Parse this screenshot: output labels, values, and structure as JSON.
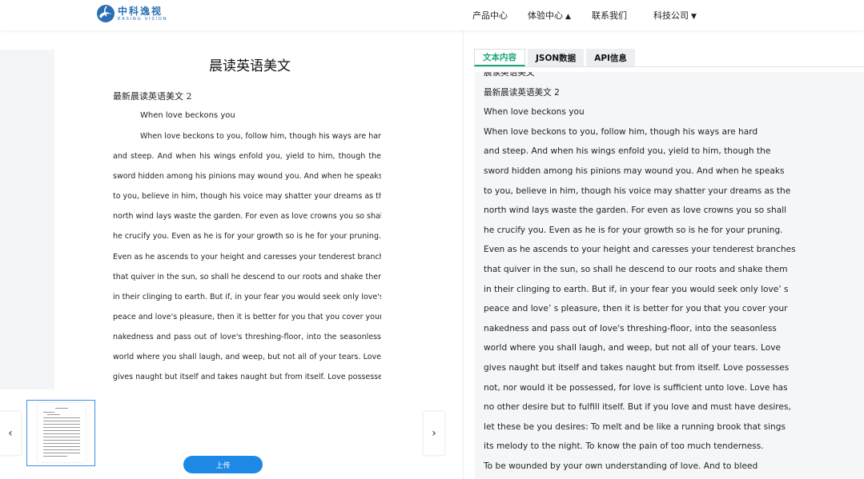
{
  "header": {
    "logo_cn": "中科逸视",
    "logo_en": "EASING VISION",
    "nav": [
      {
        "label": "产品中心",
        "caret": ""
      },
      {
        "label": "体验中心",
        "caret": "▲"
      },
      {
        "label": "联系我们",
        "caret": ""
      },
      {
        "label": "科技公司",
        "caret": "▼"
      }
    ]
  },
  "document": {
    "title": "晨读英语美文",
    "subtitle": "最新晨读英语美文 2",
    "heading": "When love beckons you",
    "lines": [
      "When love beckons to you, follow him, though his ways are hard",
      "and steep. And when his wings enfold you, yield to him, though the",
      "sword hidden among his pinions may wound you. And when he speaks",
      "to you, believe in him, though his voice may shatter your dreams as the",
      "north wind lays waste the garden. For even as love crowns you so shall",
      "he crucify you. Even as he is for your growth so is he for your pruning.",
      "Even as he ascends to your height and caresses your tenderest branches",
      "that quiver in the sun, so shall he descend to our roots and shake them",
      "in their clinging to earth. But if, in your fear you would seek only love's",
      "peace and love's pleasure, then it is better for you that you cover your",
      "nakedness and pass out of love's threshing-floor, into the seasonless",
      "world where you shall laugh, and weep, but not all of your tears. Love",
      "gives naught but itself and takes naught but from itself. Love possesses"
    ]
  },
  "controls": {
    "prev_arrow": "‹",
    "next_arrow": "›",
    "upload_label": "上传"
  },
  "tabs": [
    {
      "label": "文本内容",
      "active": true
    },
    {
      "label": "JSON数据",
      "active": false
    },
    {
      "label": "API信息",
      "active": false
    }
  ],
  "result": {
    "lines": [
      "晨读英语美文",
      "最新晨读英语美文 2",
      "When love beckons you",
      "When love beckons to you, follow him, though his ways are hard",
      "and steep. And when his wings enfold you, yield to him, though the",
      "sword hidden among his pinions may wound you. And when he speaks",
      "to you, believe in him, though his voice may shatter your dreams as the",
      "north wind lays waste the garden. For even as love crowns you so shall",
      "he crucify you. Even as he is for your growth so is he for your pruning.",
      "Even as he ascends to your height and caresses your tenderest branches",
      "that quiver in the sun, so shall he descend to our roots and shake them",
      "in their clinging to earth. But if, in your fear you would seek only love’ s",
      "peace and love’ s pleasure, then it is better for you that you cover your",
      "nakedness and pass out of love's threshing-floor, into the seasonless",
      "world where you shall laugh, and weep, but not all of your tears. Love",
      "gives naught but itself and takes naught but from itself. Love possesses",
      "not, nor would it be possessed, for love is sufficient unto love. Love has",
      "no other desire but to fulfill itself. But if you love and must have desires,",
      "let these be you desires: To melt and be like a running brook that sings",
      "its melody to the night. To know the pain of too much tenderness.",
      "To be wounded by your own understanding of love. And to bleed"
    ]
  },
  "colors": {
    "brand": "#2a6fb5",
    "accent_green": "#1aa67a",
    "upload_blue": "#1e88e5",
    "thumb_border": "#3a8ee6"
  }
}
